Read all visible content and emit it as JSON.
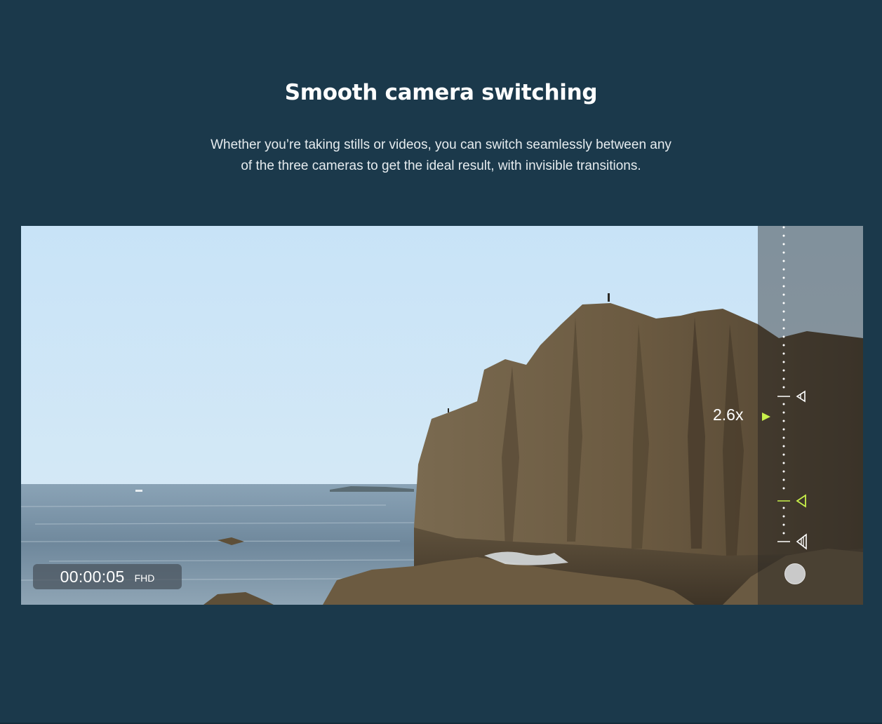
{
  "section": {
    "title": "Smooth camera switching",
    "description": "Whether you’re taking stills or videos, you can switch seamlessly between any of the three cameras to get the ideal result, with invisible transitions."
  },
  "video": {
    "scene_icon": "coastal-cliff-photo",
    "recording_time": "00:00:05",
    "quality_label": "FHD",
    "zoom_level": "2.6x",
    "zoom_slider": {
      "camera_markers": [
        "camera-lens-icon",
        "camera-lens-icon",
        "camera-lens-icon"
      ],
      "active_marker_index": 1
    }
  },
  "colors": {
    "page_background": "#1b394b",
    "accent": "#c8f04a",
    "text": "#ffffff"
  }
}
